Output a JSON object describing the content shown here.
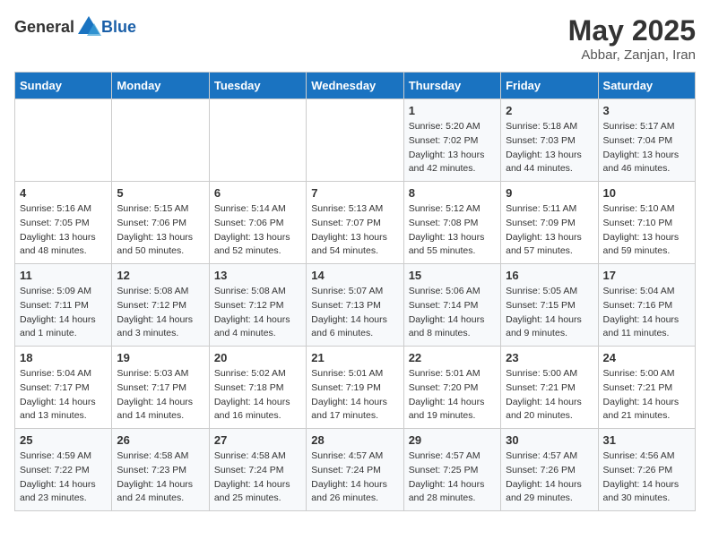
{
  "header": {
    "logo_general": "General",
    "logo_blue": "Blue",
    "month_title": "May 2025",
    "subtitle": "Abbar, Zanjan, Iran"
  },
  "days_of_week": [
    "Sunday",
    "Monday",
    "Tuesday",
    "Wednesday",
    "Thursday",
    "Friday",
    "Saturday"
  ],
  "weeks": [
    [
      {
        "day": "",
        "info": ""
      },
      {
        "day": "",
        "info": ""
      },
      {
        "day": "",
        "info": ""
      },
      {
        "day": "",
        "info": ""
      },
      {
        "day": "1",
        "info": "Sunrise: 5:20 AM\nSunset: 7:02 PM\nDaylight: 13 hours\nand 42 minutes."
      },
      {
        "day": "2",
        "info": "Sunrise: 5:18 AM\nSunset: 7:03 PM\nDaylight: 13 hours\nand 44 minutes."
      },
      {
        "day": "3",
        "info": "Sunrise: 5:17 AM\nSunset: 7:04 PM\nDaylight: 13 hours\nand 46 minutes."
      }
    ],
    [
      {
        "day": "4",
        "info": "Sunrise: 5:16 AM\nSunset: 7:05 PM\nDaylight: 13 hours\nand 48 minutes."
      },
      {
        "day": "5",
        "info": "Sunrise: 5:15 AM\nSunset: 7:06 PM\nDaylight: 13 hours\nand 50 minutes."
      },
      {
        "day": "6",
        "info": "Sunrise: 5:14 AM\nSunset: 7:06 PM\nDaylight: 13 hours\nand 52 minutes."
      },
      {
        "day": "7",
        "info": "Sunrise: 5:13 AM\nSunset: 7:07 PM\nDaylight: 13 hours\nand 54 minutes."
      },
      {
        "day": "8",
        "info": "Sunrise: 5:12 AM\nSunset: 7:08 PM\nDaylight: 13 hours\nand 55 minutes."
      },
      {
        "day": "9",
        "info": "Sunrise: 5:11 AM\nSunset: 7:09 PM\nDaylight: 13 hours\nand 57 minutes."
      },
      {
        "day": "10",
        "info": "Sunrise: 5:10 AM\nSunset: 7:10 PM\nDaylight: 13 hours\nand 59 minutes."
      }
    ],
    [
      {
        "day": "11",
        "info": "Sunrise: 5:09 AM\nSunset: 7:11 PM\nDaylight: 14 hours\nand 1 minute."
      },
      {
        "day": "12",
        "info": "Sunrise: 5:08 AM\nSunset: 7:12 PM\nDaylight: 14 hours\nand 3 minutes."
      },
      {
        "day": "13",
        "info": "Sunrise: 5:08 AM\nSunset: 7:12 PM\nDaylight: 14 hours\nand 4 minutes."
      },
      {
        "day": "14",
        "info": "Sunrise: 5:07 AM\nSunset: 7:13 PM\nDaylight: 14 hours\nand 6 minutes."
      },
      {
        "day": "15",
        "info": "Sunrise: 5:06 AM\nSunset: 7:14 PM\nDaylight: 14 hours\nand 8 minutes."
      },
      {
        "day": "16",
        "info": "Sunrise: 5:05 AM\nSunset: 7:15 PM\nDaylight: 14 hours\nand 9 minutes."
      },
      {
        "day": "17",
        "info": "Sunrise: 5:04 AM\nSunset: 7:16 PM\nDaylight: 14 hours\nand 11 minutes."
      }
    ],
    [
      {
        "day": "18",
        "info": "Sunrise: 5:04 AM\nSunset: 7:17 PM\nDaylight: 14 hours\nand 13 minutes."
      },
      {
        "day": "19",
        "info": "Sunrise: 5:03 AM\nSunset: 7:17 PM\nDaylight: 14 hours\nand 14 minutes."
      },
      {
        "day": "20",
        "info": "Sunrise: 5:02 AM\nSunset: 7:18 PM\nDaylight: 14 hours\nand 16 minutes."
      },
      {
        "day": "21",
        "info": "Sunrise: 5:01 AM\nSunset: 7:19 PM\nDaylight: 14 hours\nand 17 minutes."
      },
      {
        "day": "22",
        "info": "Sunrise: 5:01 AM\nSunset: 7:20 PM\nDaylight: 14 hours\nand 19 minutes."
      },
      {
        "day": "23",
        "info": "Sunrise: 5:00 AM\nSunset: 7:21 PM\nDaylight: 14 hours\nand 20 minutes."
      },
      {
        "day": "24",
        "info": "Sunrise: 5:00 AM\nSunset: 7:21 PM\nDaylight: 14 hours\nand 21 minutes."
      }
    ],
    [
      {
        "day": "25",
        "info": "Sunrise: 4:59 AM\nSunset: 7:22 PM\nDaylight: 14 hours\nand 23 minutes."
      },
      {
        "day": "26",
        "info": "Sunrise: 4:58 AM\nSunset: 7:23 PM\nDaylight: 14 hours\nand 24 minutes."
      },
      {
        "day": "27",
        "info": "Sunrise: 4:58 AM\nSunset: 7:24 PM\nDaylight: 14 hours\nand 25 minutes."
      },
      {
        "day": "28",
        "info": "Sunrise: 4:57 AM\nSunset: 7:24 PM\nDaylight: 14 hours\nand 26 minutes."
      },
      {
        "day": "29",
        "info": "Sunrise: 4:57 AM\nSunset: 7:25 PM\nDaylight: 14 hours\nand 28 minutes."
      },
      {
        "day": "30",
        "info": "Sunrise: 4:57 AM\nSunset: 7:26 PM\nDaylight: 14 hours\nand 29 minutes."
      },
      {
        "day": "31",
        "info": "Sunrise: 4:56 AM\nSunset: 7:26 PM\nDaylight: 14 hours\nand 30 minutes."
      }
    ]
  ]
}
